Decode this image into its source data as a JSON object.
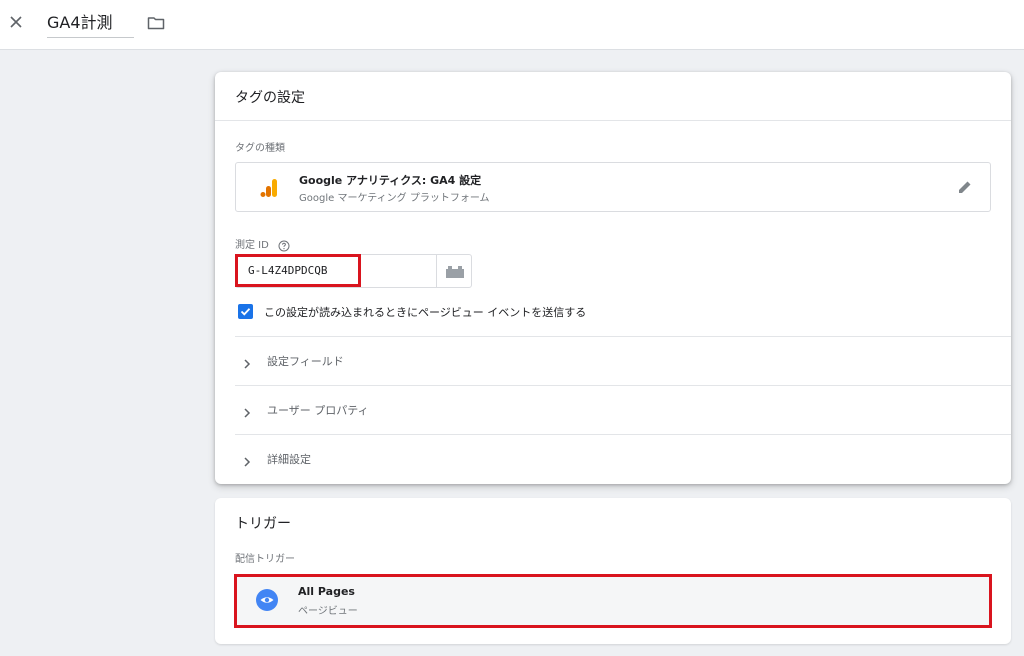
{
  "topbar": {
    "title": "GA4計測",
    "close_icon": "close-icon",
    "folder_icon": "folder-icon"
  },
  "tag_config": {
    "heading": "タグの設定",
    "tag_type_label": "タグの種類",
    "tag_type": {
      "name": "Google アナリティクス: GA4 設定",
      "provider": "Google マーケティング プラットフォーム",
      "icon": "google-analytics-icon",
      "edit_icon": "pencil-icon"
    },
    "measurement_id_label": "測定 ID",
    "measurement_id_value": "G-L4Z4DPDCQB",
    "variable_icon": "lego-block-icon",
    "send_pageview": {
      "checked": true,
      "label": "この設定が読み込まれるときにページビュー イベントを送信する"
    },
    "expanders": [
      {
        "label": "設定フィールド"
      },
      {
        "label": "ユーザー プロパティ"
      },
      {
        "label": "詳細設定"
      }
    ]
  },
  "triggering": {
    "heading": "トリガー",
    "firing_label": "配信トリガー",
    "trigger": {
      "name": "All Pages",
      "type": "ページビュー",
      "icon": "eye-icon"
    }
  },
  "colors": {
    "accent_blue": "#1a73e8",
    "ga_orange": "#f9ab00",
    "ga_dark_orange": "#e37400",
    "highlight_red": "#d9141e"
  }
}
